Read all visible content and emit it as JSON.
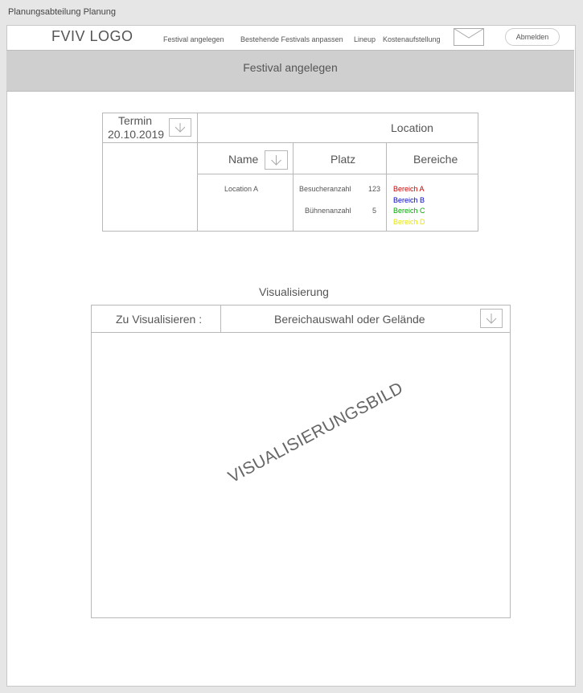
{
  "window_title": "Planungsabteilung Planung",
  "header": {
    "logo": "FVIV LOGO",
    "nav": [
      "Festival angelegen",
      "Bestehende Festivals anpassen",
      "Lineup",
      "Kostenaufstellung"
    ],
    "mail_icon": "mail-icon",
    "logout_label": "Abmelden"
  },
  "banner": {
    "title": "Festival angelegen"
  },
  "termin": {
    "label": "Termin",
    "date": "20.10.2019"
  },
  "location": {
    "title": "Location",
    "columns": [
      "Name",
      "Platz",
      "Bereiche"
    ],
    "name": "Location A",
    "platz": [
      {
        "label": "Besucheranzahl",
        "value": "123"
      },
      {
        "label": "Bühnenanzahl",
        "value": "5"
      }
    ],
    "bereiche": [
      {
        "label": "Bereich A",
        "color": "#cc0000"
      },
      {
        "label": "Bereich B",
        "color": "#0000cc"
      },
      {
        "label": "Bereich C",
        "color": "#00aa00"
      },
      {
        "label": "Bereich D",
        "color": "#e6e600"
      }
    ]
  },
  "visualisierung": {
    "title": "Visualisierung",
    "label": "Zu Visualisieren :",
    "select_value": "Bereichauswahl oder Gelände",
    "image_placeholder": "VISUALISIERUNGSBILD"
  }
}
